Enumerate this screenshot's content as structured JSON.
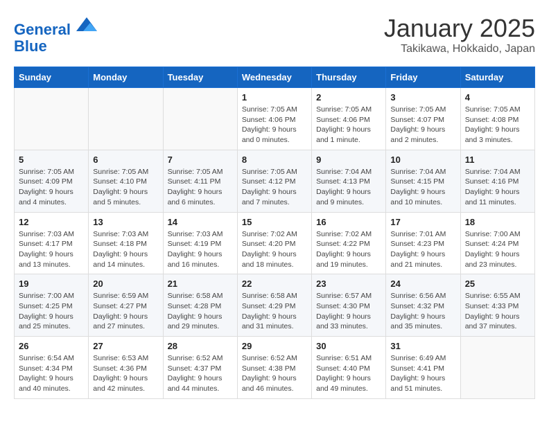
{
  "header": {
    "logo_line1": "General",
    "logo_line2": "Blue",
    "month": "January 2025",
    "location": "Takikawa, Hokkaido, Japan"
  },
  "days_of_week": [
    "Sunday",
    "Monday",
    "Tuesday",
    "Wednesday",
    "Thursday",
    "Friday",
    "Saturday"
  ],
  "weeks": [
    [
      {
        "day": "",
        "info": ""
      },
      {
        "day": "",
        "info": ""
      },
      {
        "day": "",
        "info": ""
      },
      {
        "day": "1",
        "info": "Sunrise: 7:05 AM\nSunset: 4:06 PM\nDaylight: 9 hours\nand 0 minutes."
      },
      {
        "day": "2",
        "info": "Sunrise: 7:05 AM\nSunset: 4:06 PM\nDaylight: 9 hours\nand 1 minute."
      },
      {
        "day": "3",
        "info": "Sunrise: 7:05 AM\nSunset: 4:07 PM\nDaylight: 9 hours\nand 2 minutes."
      },
      {
        "day": "4",
        "info": "Sunrise: 7:05 AM\nSunset: 4:08 PM\nDaylight: 9 hours\nand 3 minutes."
      }
    ],
    [
      {
        "day": "5",
        "info": "Sunrise: 7:05 AM\nSunset: 4:09 PM\nDaylight: 9 hours\nand 4 minutes."
      },
      {
        "day": "6",
        "info": "Sunrise: 7:05 AM\nSunset: 4:10 PM\nDaylight: 9 hours\nand 5 minutes."
      },
      {
        "day": "7",
        "info": "Sunrise: 7:05 AM\nSunset: 4:11 PM\nDaylight: 9 hours\nand 6 minutes."
      },
      {
        "day": "8",
        "info": "Sunrise: 7:05 AM\nSunset: 4:12 PM\nDaylight: 9 hours\nand 7 minutes."
      },
      {
        "day": "9",
        "info": "Sunrise: 7:04 AM\nSunset: 4:13 PM\nDaylight: 9 hours\nand 9 minutes."
      },
      {
        "day": "10",
        "info": "Sunrise: 7:04 AM\nSunset: 4:15 PM\nDaylight: 9 hours\nand 10 minutes."
      },
      {
        "day": "11",
        "info": "Sunrise: 7:04 AM\nSunset: 4:16 PM\nDaylight: 9 hours\nand 11 minutes."
      }
    ],
    [
      {
        "day": "12",
        "info": "Sunrise: 7:03 AM\nSunset: 4:17 PM\nDaylight: 9 hours\nand 13 minutes."
      },
      {
        "day": "13",
        "info": "Sunrise: 7:03 AM\nSunset: 4:18 PM\nDaylight: 9 hours\nand 14 minutes."
      },
      {
        "day": "14",
        "info": "Sunrise: 7:03 AM\nSunset: 4:19 PM\nDaylight: 9 hours\nand 16 minutes."
      },
      {
        "day": "15",
        "info": "Sunrise: 7:02 AM\nSunset: 4:20 PM\nDaylight: 9 hours\nand 18 minutes."
      },
      {
        "day": "16",
        "info": "Sunrise: 7:02 AM\nSunset: 4:22 PM\nDaylight: 9 hours\nand 19 minutes."
      },
      {
        "day": "17",
        "info": "Sunrise: 7:01 AM\nSunset: 4:23 PM\nDaylight: 9 hours\nand 21 minutes."
      },
      {
        "day": "18",
        "info": "Sunrise: 7:00 AM\nSunset: 4:24 PM\nDaylight: 9 hours\nand 23 minutes."
      }
    ],
    [
      {
        "day": "19",
        "info": "Sunrise: 7:00 AM\nSunset: 4:25 PM\nDaylight: 9 hours\nand 25 minutes."
      },
      {
        "day": "20",
        "info": "Sunrise: 6:59 AM\nSunset: 4:27 PM\nDaylight: 9 hours\nand 27 minutes."
      },
      {
        "day": "21",
        "info": "Sunrise: 6:58 AM\nSunset: 4:28 PM\nDaylight: 9 hours\nand 29 minutes."
      },
      {
        "day": "22",
        "info": "Sunrise: 6:58 AM\nSunset: 4:29 PM\nDaylight: 9 hours\nand 31 minutes."
      },
      {
        "day": "23",
        "info": "Sunrise: 6:57 AM\nSunset: 4:30 PM\nDaylight: 9 hours\nand 33 minutes."
      },
      {
        "day": "24",
        "info": "Sunrise: 6:56 AM\nSunset: 4:32 PM\nDaylight: 9 hours\nand 35 minutes."
      },
      {
        "day": "25",
        "info": "Sunrise: 6:55 AM\nSunset: 4:33 PM\nDaylight: 9 hours\nand 37 minutes."
      }
    ],
    [
      {
        "day": "26",
        "info": "Sunrise: 6:54 AM\nSunset: 4:34 PM\nDaylight: 9 hours\nand 40 minutes."
      },
      {
        "day": "27",
        "info": "Sunrise: 6:53 AM\nSunset: 4:36 PM\nDaylight: 9 hours\nand 42 minutes."
      },
      {
        "day": "28",
        "info": "Sunrise: 6:52 AM\nSunset: 4:37 PM\nDaylight: 9 hours\nand 44 minutes."
      },
      {
        "day": "29",
        "info": "Sunrise: 6:52 AM\nSunset: 4:38 PM\nDaylight: 9 hours\nand 46 minutes."
      },
      {
        "day": "30",
        "info": "Sunrise: 6:51 AM\nSunset: 4:40 PM\nDaylight: 9 hours\nand 49 minutes."
      },
      {
        "day": "31",
        "info": "Sunrise: 6:49 AM\nSunset: 4:41 PM\nDaylight: 9 hours\nand 51 minutes."
      },
      {
        "day": "",
        "info": ""
      }
    ]
  ]
}
